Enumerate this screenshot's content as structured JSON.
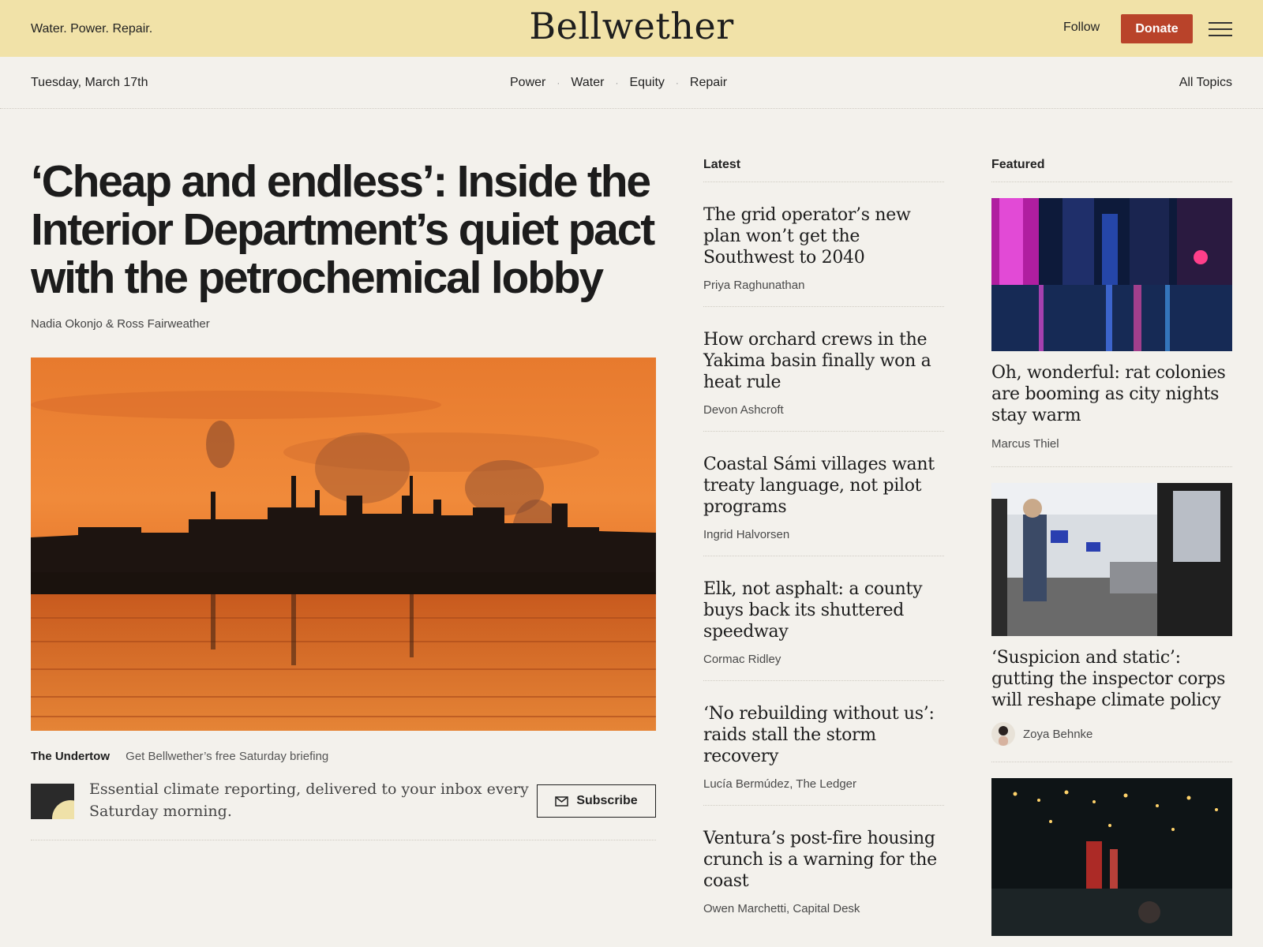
{
  "header": {
    "tagline": "Water. Power. Repair.",
    "logo": "Bellwether",
    "follow_label": "Follow",
    "donate_label": "Donate",
    "menu_icon": "hamburger-menu-icon"
  },
  "subnav": {
    "date": "Tuesday, March 17th",
    "topics": [
      "Power",
      "Water",
      "Equity",
      "Repair"
    ],
    "all_topics_label": "All Topics"
  },
  "lead": {
    "title": "‘Cheap and endless’: Inside the Interior Department’s quiet pact with the petrochemical lobby",
    "byline": "Nadia Okonjo & Ross Fairweather"
  },
  "newsletter": {
    "name": "The Undertow",
    "subtitle": "Get Bellwether’s free Saturday briefing",
    "description": "Essential climate reporting, delivered to your inbox every Saturday morning.",
    "subscribe_label": "Subscribe",
    "subscribe_icon": "mail-icon"
  },
  "latest": {
    "heading": "Latest",
    "items": [
      {
        "headline": "The grid operator’s new plan won’t get the Southwest to 2040",
        "byline": "Priya Raghunathan"
      },
      {
        "headline": "How orchard crews in the Yakima basin finally won a heat rule",
        "byline": "Devon Ashcroft"
      },
      {
        "headline": "Coastal Sámi villages want treaty language, not pilot programs",
        "byline": "Ingrid Halvorsen"
      },
      {
        "headline": "Elk, not asphalt: a county buys back its shuttered speedway",
        "byline": "Cormac Ridley"
      },
      {
        "headline": "‘No rebuilding without us’: raids stall the storm recovery",
        "byline": "Lucía Bermúdez, The Ledger"
      },
      {
        "headline": "Ventura’s post-fire housing crunch is a warning for the coast",
        "byline": "Owen Marchetti, Capital Desk"
      }
    ]
  },
  "featured": {
    "heading": "Featured",
    "items": [
      {
        "headline": "Oh, wonderful: rat colonies are booming as city nights stay warm",
        "byline": "Marcus Thiel"
      },
      {
        "headline": "‘Suspicion and static’: gutting the inspector corps will reshape climate policy",
        "byline": "Zoya Behnke"
      }
    ]
  }
}
